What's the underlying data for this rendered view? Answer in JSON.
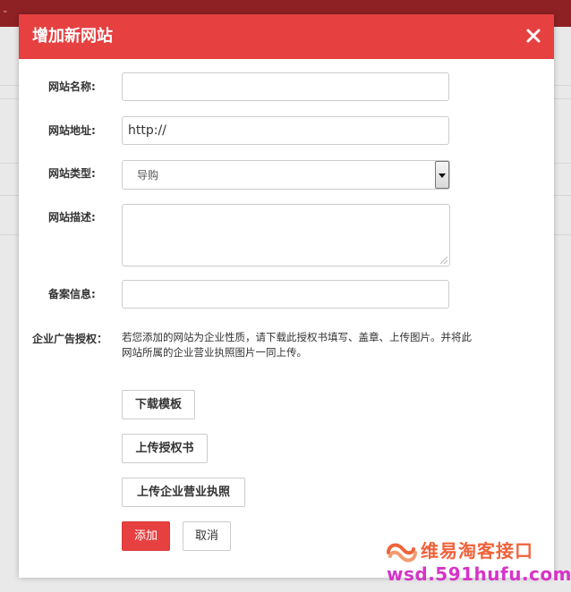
{
  "dialog": {
    "title": "增加新网站",
    "close_icon": "close-icon"
  },
  "form": {
    "name": {
      "label": "网站名称:",
      "value": "",
      "placeholder": ""
    },
    "url": {
      "label": "网站地址:",
      "value": "http://"
    },
    "type": {
      "label": "网站类型:",
      "selected": "导购"
    },
    "description": {
      "label": "网站描述:",
      "value": ""
    },
    "icp": {
      "label": "备案信息:",
      "value": ""
    },
    "ad_auth": {
      "label": "企业广告授权：",
      "notice_line1": "若您添加的网站为企业性质，请下载此授权书填写、盖章、上传图片。并将此",
      "notice_line2": "网站所属的企业营业执照图片一同上传。"
    }
  },
  "buttons": {
    "download_template": "下载模板",
    "upload_authorization": "上传授权书",
    "upload_license": "上传企业营业执照",
    "add": "添加",
    "cancel": "取消"
  },
  "watermark": {
    "title": "维易淘客接口",
    "url": "wsd.591hufu.com"
  },
  "colors": {
    "header": "#e64041",
    "primary_button": "#e64041",
    "watermark_title": "#f0623a",
    "watermark_url": "#d634c7"
  }
}
